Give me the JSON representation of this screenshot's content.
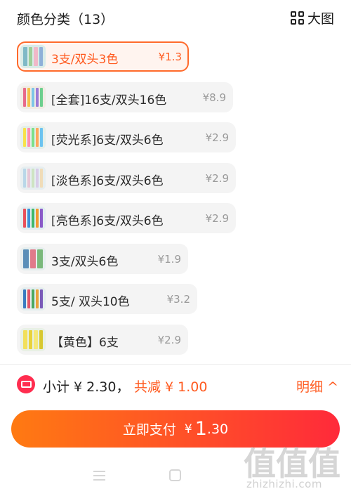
{
  "header": {
    "title": "颜色分类（13）",
    "view_toggle_label": "大图",
    "view_toggle_icon": "grid-icon"
  },
  "options": [
    {
      "label": "3支/双头3色",
      "price": "¥1.3",
      "selected": true
    },
    {
      "label": "[全套]16支/双头16色",
      "price": "¥8.9",
      "selected": false
    },
    {
      "label": "[荧光系]6支/双头6色",
      "price": "¥2.9",
      "selected": false
    },
    {
      "label": "[淡色系]6支/双头6色",
      "price": "¥2.9",
      "selected": false
    },
    {
      "label": "[亮色系]6支/双头6色",
      "price": "¥2.9",
      "selected": false
    },
    {
      "label": "3支/双头6色",
      "price": "¥1.9",
      "selected": false
    },
    {
      "label": "5支/ 双头10色",
      "price": "¥3.2",
      "selected": false
    },
    {
      "label": "【黄色】6支",
      "price": "¥2.9",
      "selected": false
    }
  ],
  "summary": {
    "icon": "coupon-icon",
    "subtotal": "小计 ¥ 2.30，",
    "discount": "共减 ¥ 1.00",
    "detail_label": "明细 ^"
  },
  "pay": {
    "label": "立即支付",
    "currency": "¥",
    "amount_int": "1",
    "amount_dec": ".30"
  },
  "navbar": {
    "menu_icon": "menu-icon",
    "home_icon": "home-icon"
  },
  "watermark": {
    "glyphs": "值值值",
    "text": "zhizhizhi.com"
  },
  "colors": {
    "accent": "#ff5a1f",
    "selected_bg": "#fff4ef",
    "option_bg": "#f4f4f4",
    "pay_gradient_start": "#ff7a12",
    "pay_gradient_end": "#ff2a3a",
    "coupon_red": "#ff2d4f"
  }
}
